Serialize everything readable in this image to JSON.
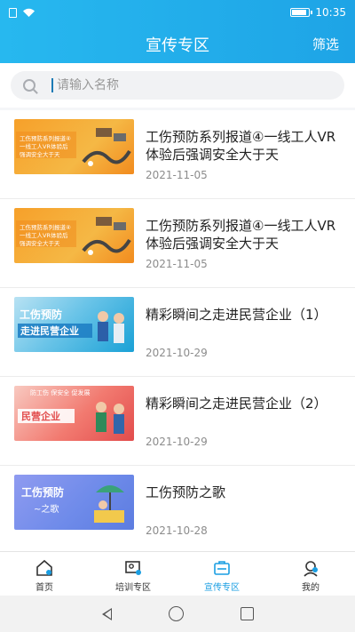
{
  "status": {
    "time": "10:35"
  },
  "header": {
    "title": "宣传专区",
    "filter_label": "筛选"
  },
  "search": {
    "placeholder": "请输入名称"
  },
  "items": [
    {
      "title": "工伤预防系列报道④一线工人VR体验后强调安全大于天",
      "date": "2021-11-05",
      "thumb_text": "工伤预防系列报道④ 一线工人VR体验后 强调安全大于天",
      "thumb": "orange"
    },
    {
      "title": "工伤预防系列报道④一线工人VR体验后强调安全大于天",
      "date": "2021-11-05",
      "thumb_text": "工伤预防系列报道④ 一线工人VR体验后 强调安全大于天",
      "thumb": "orange"
    },
    {
      "title": "精彩瞬间之走进民营企业（1）",
      "date": "2021-10-29",
      "thumb_text": "工伤预防 走进民营企业",
      "thumb": "blue"
    },
    {
      "title": "精彩瞬间之走进民营企业（2）",
      "date": "2021-10-29",
      "thumb_text": "防工伤 保安全 促发展 民营企业",
      "thumb": "red"
    },
    {
      "title": "工伤预防之歌",
      "date": "2021-10-28",
      "thumb_text": "工伤预防 ~之歌",
      "thumb": "purple"
    }
  ],
  "tabs": [
    {
      "label": "首页",
      "icon": "home-icon",
      "active": false
    },
    {
      "label": "培训专区",
      "icon": "training-icon",
      "active": false
    },
    {
      "label": "宣传专区",
      "icon": "publicity-icon",
      "active": true
    },
    {
      "label": "我的",
      "icon": "user-icon",
      "active": false
    }
  ],
  "colors": {
    "accent": "#1a9ee2",
    "header": "#22aeea"
  }
}
